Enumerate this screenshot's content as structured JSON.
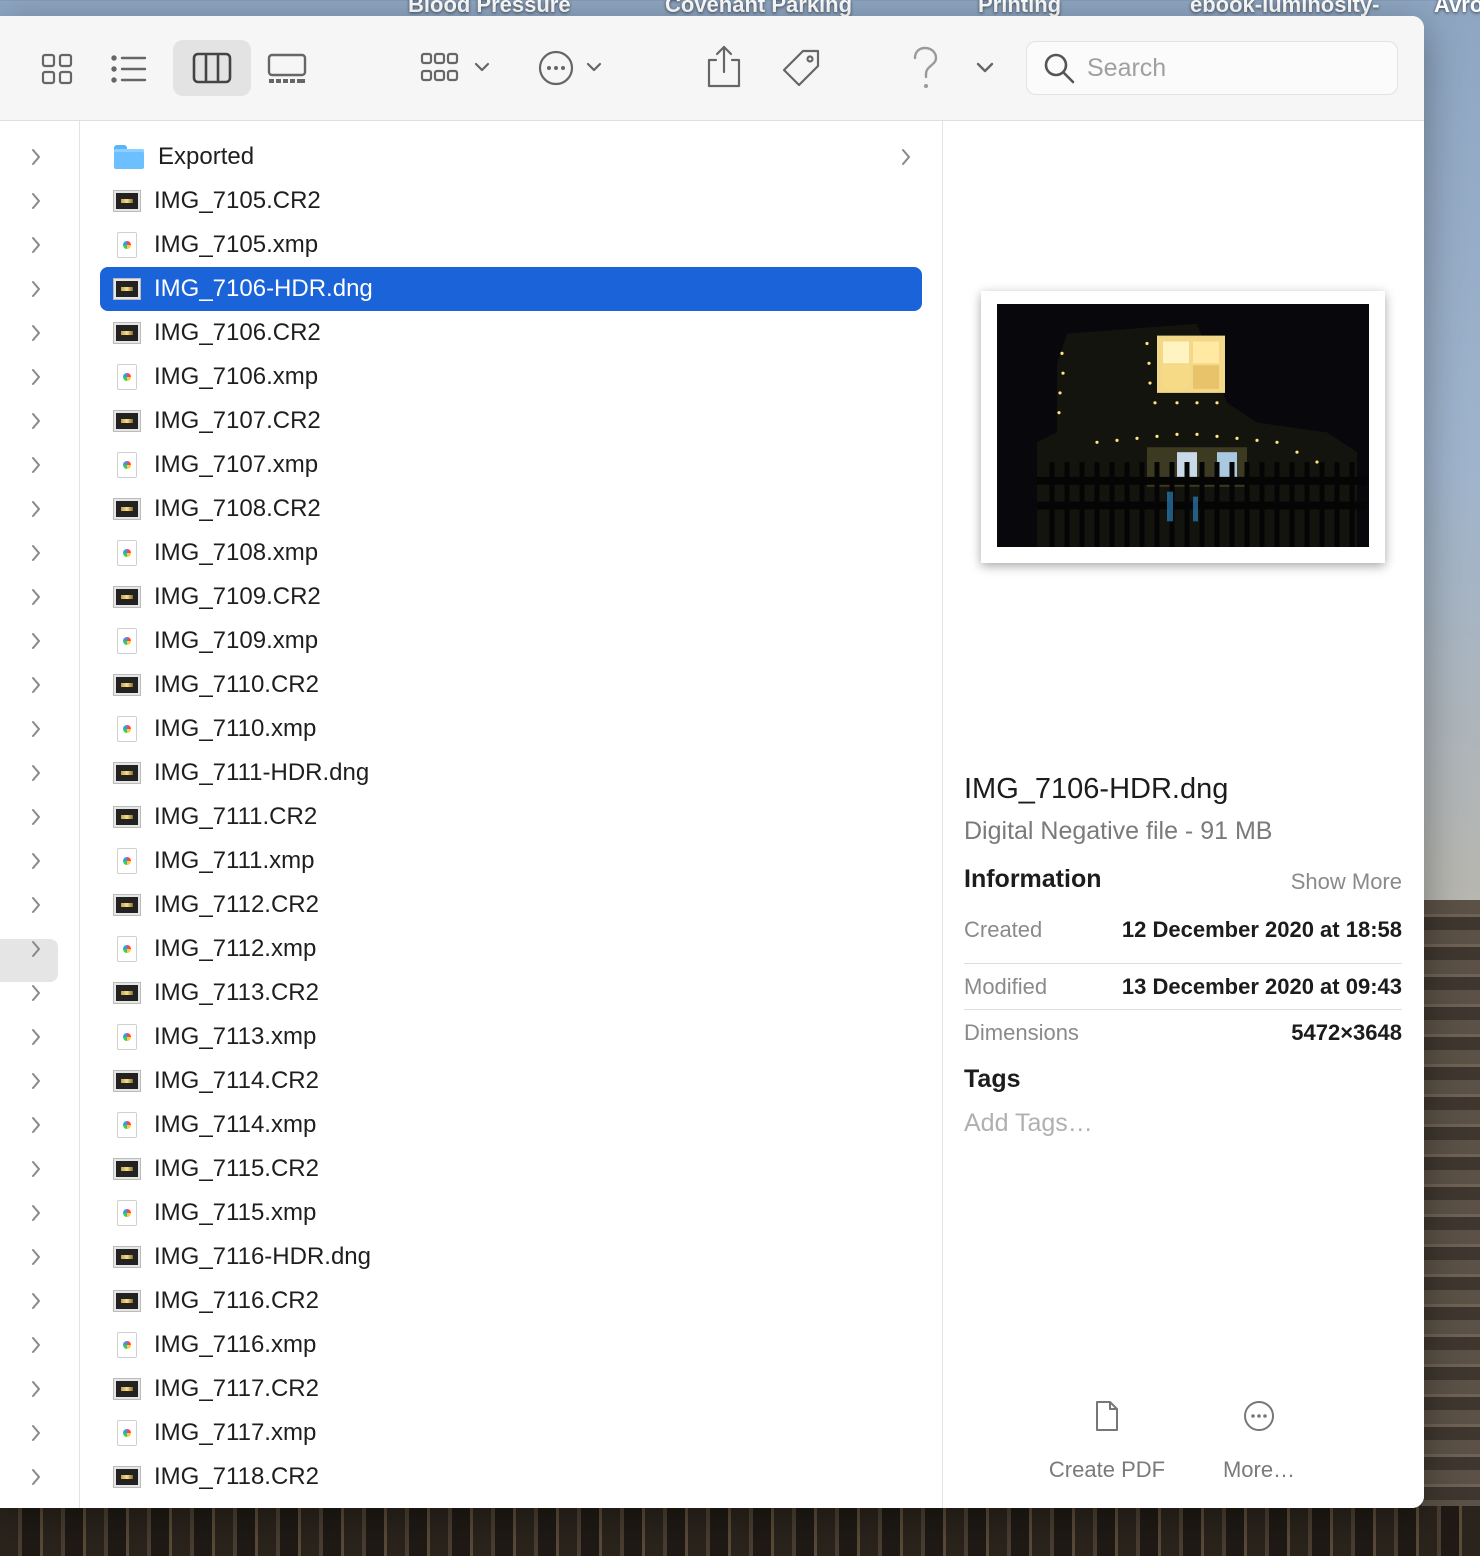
{
  "desktop": {
    "labels": [
      "Blood Pressure",
      "Covenant Parking",
      "Printing",
      "ebook-luminosity-",
      "Avro"
    ]
  },
  "toolbar": {
    "view_icons": "icon-view-icon",
    "view_list": "list-view-icon",
    "view_columns": "column-view-icon",
    "view_gallery": "gallery-view-icon",
    "group": "group-icon",
    "action": "ellipsis-icon",
    "share": "share-icon",
    "tag": "tag-icon",
    "help": "question-icon",
    "search_placeholder": "Search"
  },
  "files": [
    {
      "name": "Exported",
      "type": "folder"
    },
    {
      "name": "IMG_7105.CR2",
      "type": "raw"
    },
    {
      "name": "IMG_7105.xmp",
      "type": "xmp"
    },
    {
      "name": "IMG_7106-HDR.dng",
      "type": "raw",
      "selected": true
    },
    {
      "name": "IMG_7106.CR2",
      "type": "raw"
    },
    {
      "name": "IMG_7106.xmp",
      "type": "xmp"
    },
    {
      "name": "IMG_7107.CR2",
      "type": "raw"
    },
    {
      "name": "IMG_7107.xmp",
      "type": "xmp"
    },
    {
      "name": "IMG_7108.CR2",
      "type": "raw"
    },
    {
      "name": "IMG_7108.xmp",
      "type": "xmp"
    },
    {
      "name": "IMG_7109.CR2",
      "type": "raw"
    },
    {
      "name": "IMG_7109.xmp",
      "type": "xmp"
    },
    {
      "name": "IMG_7110.CR2",
      "type": "raw"
    },
    {
      "name": "IMG_7110.xmp",
      "type": "xmp"
    },
    {
      "name": "IMG_7111-HDR.dng",
      "type": "raw"
    },
    {
      "name": "IMG_7111.CR2",
      "type": "raw"
    },
    {
      "name": "IMG_7111.xmp",
      "type": "xmp"
    },
    {
      "name": "IMG_7112.CR2",
      "type": "raw"
    },
    {
      "name": "IMG_7112.xmp",
      "type": "xmp"
    },
    {
      "name": "IMG_7113.CR2",
      "type": "raw"
    },
    {
      "name": "IMG_7113.xmp",
      "type": "xmp"
    },
    {
      "name": "IMG_7114.CR2",
      "type": "raw"
    },
    {
      "name": "IMG_7114.xmp",
      "type": "xmp"
    },
    {
      "name": "IMG_7115.CR2",
      "type": "raw"
    },
    {
      "name": "IMG_7115.xmp",
      "type": "xmp"
    },
    {
      "name": "IMG_7116-HDR.dng",
      "type": "raw"
    },
    {
      "name": "IMG_7116.CR2",
      "type": "raw"
    },
    {
      "name": "IMG_7116.xmp",
      "type": "xmp"
    },
    {
      "name": "IMG_7117.CR2",
      "type": "raw"
    },
    {
      "name": "IMG_7117.xmp",
      "type": "xmp"
    },
    {
      "name": "IMG_7118.CR2",
      "type": "raw"
    }
  ],
  "preview": {
    "title": "IMG_7106-HDR.dng",
    "subtitle": "Digital Negative file - 91 MB",
    "info_heading": "Information",
    "show_more": "Show More",
    "info": [
      {
        "key": "Created",
        "value": "12 December 2020 at 18:58"
      },
      {
        "key": "Modified",
        "value": "13 December 2020 at 09:43"
      },
      {
        "key": "Dimensions",
        "value": "5472×3648"
      }
    ],
    "tags_heading": "Tags",
    "tags_placeholder": "Add Tags…",
    "actions": [
      {
        "label": "Create PDF",
        "icon": "document-icon"
      },
      {
        "label": "More…",
        "icon": "ellipsis-icon"
      }
    ]
  },
  "colors": {
    "selection": "#1a63d8",
    "accent": "#1a63d8"
  }
}
